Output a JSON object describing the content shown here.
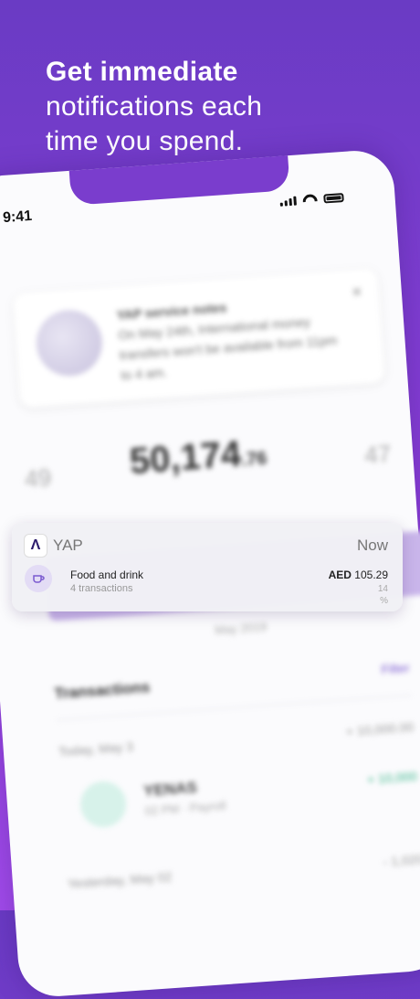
{
  "headline": {
    "bold": "Get immediate",
    "line2": "notifications each",
    "line3": "time you spend."
  },
  "status_bar": {
    "time": "9:41",
    "icons": [
      "signal-icon",
      "wifi-icon",
      "battery-icon"
    ]
  },
  "service_card": {
    "title": "YAP service notes",
    "body": "On May 24th, International money transfers won't be available from 11pm to 4 am."
  },
  "balance": {
    "left": "49",
    "main": "50,174",
    "cents": ".76",
    "right": "47"
  },
  "month_label": "May 2019",
  "transactions": {
    "title": "Transactions",
    "filter": "Filter",
    "today_label": "Today, May 3",
    "today_total": "+ 10,000.00",
    "row1": {
      "name": "YENAS",
      "sub": "02 PM · Payroll",
      "amount": "+ 10,000"
    },
    "yesterday_label": "Yesterday, May 02",
    "yesterday_total": "- 1,020"
  },
  "notification": {
    "app_name": "YAP",
    "app_logo": "Λ",
    "time": "Now",
    "title": "Food and drink",
    "subtitle": "4 transactions",
    "currency": "AED",
    "amount": "105.29",
    "percent_value": "14",
    "percent_sign": "%"
  },
  "colors": {
    "background_top": "#6a3bc4",
    "background_bottom": "#a14bea",
    "accent": "#7b5ad0",
    "positive": "#39b58a"
  }
}
